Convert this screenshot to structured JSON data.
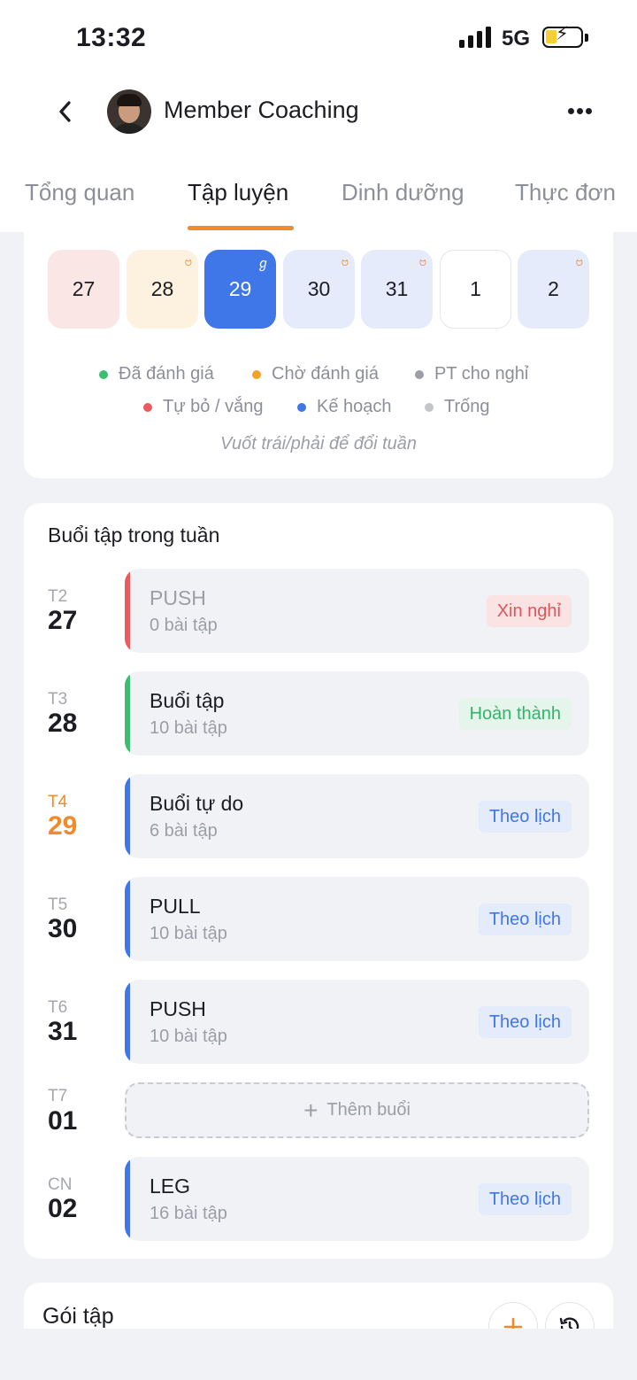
{
  "status_bar": {
    "time": "13:32",
    "network": "5G"
  },
  "header": {
    "title": "Member Coaching"
  },
  "tabs": [
    {
      "label": "Tổng quan",
      "active": false
    },
    {
      "label": "Tập luyện",
      "active": true
    },
    {
      "label": "Dinh dưỡng",
      "active": false
    },
    {
      "label": "Thực đơn",
      "active": false
    }
  ],
  "calendar": {
    "weekdays": [
      "T2",
      "T3",
      "T4",
      "T5",
      "T6",
      "T7",
      "CN"
    ],
    "days": [
      "27",
      "28",
      "29",
      "30",
      "31",
      "1",
      "2"
    ],
    "legend": [
      {
        "label": "Đã đánh giá",
        "color": "#3dbd72"
      },
      {
        "label": "Chờ đánh giá",
        "color": "#f2a328"
      },
      {
        "label": "PT cho nghỉ",
        "color": "#9c9ea6"
      },
      {
        "label": "Tự bỏ / vắng",
        "color": "#ea5a5f"
      },
      {
        "label": "Kế hoạch",
        "color": "#3f77e8"
      },
      {
        "label": "Trống",
        "color": "#c3c5cb"
      }
    ],
    "swipe_hint": "Vuốt trái/phải để đổi tuần"
  },
  "week": {
    "title": "Buổi tập trong tuần",
    "rows": [
      {
        "weekday": "T2",
        "day": "27",
        "name": "PUSH",
        "count": "0 bài tập",
        "badge": "Xin nghỉ",
        "bar_color": "#ea5a5f",
        "badge_bg": "#fbe3e3",
        "badge_color": "#e0555a"
      },
      {
        "weekday": "T3",
        "day": "28",
        "name": "Buổi tập",
        "count": "10 bài tập",
        "badge": "Hoàn thành",
        "bar_color": "#3dbd72",
        "badge_bg": "#e6f5ec",
        "badge_color": "#32b36a"
      },
      {
        "weekday": "T4",
        "day": "29",
        "name": "Buổi tự do",
        "count": "6 bài tập",
        "badge": "Theo lịch",
        "bar_color": "#3f77e8",
        "badge_bg": "#e4ebfb",
        "badge_color": "#3f77e8"
      },
      {
        "weekday": "T5",
        "day": "30",
        "name": "PULL",
        "count": "10 bài tập",
        "badge": "Theo lịch",
        "bar_color": "#3f77e8",
        "badge_bg": "#e4ebfb",
        "badge_color": "#3f77e8"
      },
      {
        "weekday": "T6",
        "day": "31",
        "name": "PUSH",
        "count": "10 bài tập",
        "badge": "Theo lịch",
        "bar_color": "#3f77e8",
        "badge_bg": "#e4ebfb",
        "badge_color": "#3f77e8"
      },
      {
        "weekday": "T7",
        "day": "01",
        "add_label": "Thêm buổi"
      },
      {
        "weekday": "CN",
        "day": "02",
        "name": "LEG",
        "count": "16 bài tập",
        "badge": "Theo lịch",
        "bar_color": "#3f77e8",
        "badge_bg": "#e4ebfb",
        "badge_color": "#3f77e8"
      }
    ]
  },
  "package": {
    "title": "Gói tập"
  },
  "colors": {
    "accent": "#f08a2a",
    "primary": "#3f77e8"
  }
}
